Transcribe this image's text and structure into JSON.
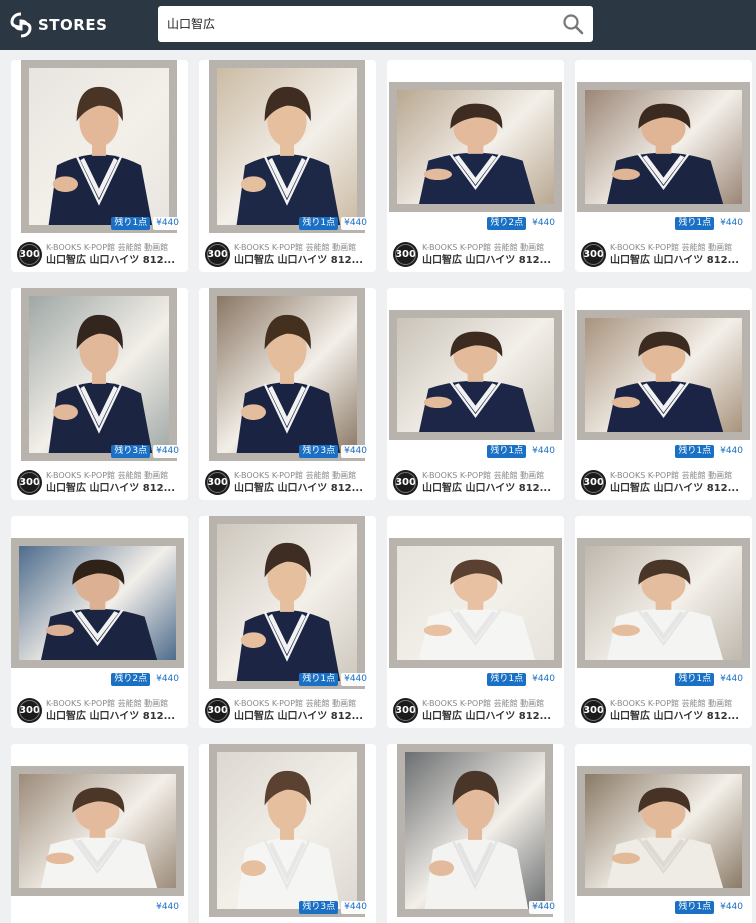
{
  "header": {
    "logo_text": "STORES",
    "search_value": "山口智広",
    "search_icon": "search-icon"
  },
  "items": [
    {
      "stock": "残り1点",
      "price": "¥440",
      "shop": "K-BOOKS K-POP館 芸能館 動画館",
      "title": "山口智広 山口ハイツ 812..."
    },
    {
      "stock": "残り1点",
      "price": "¥440",
      "shop": "K-BOOKS K-POP館 芸能館 動画館",
      "title": "山口智広 山口ハイツ 812..."
    },
    {
      "stock": "残り2点",
      "price": "¥440",
      "shop": "K-BOOKS K-POP館 芸能館 動画館",
      "title": "山口智広 山口ハイツ 812..."
    },
    {
      "stock": "残り1点",
      "price": "¥440",
      "shop": "K-BOOKS K-POP館 芸能館 動画館",
      "title": "山口智広 山口ハイツ 812..."
    },
    {
      "stock": "残り3点",
      "price": "¥440",
      "shop": "K-BOOKS K-POP館 芸能館 動画館",
      "title": "山口智広 山口ハイツ 812..."
    },
    {
      "stock": "残り3点",
      "price": "¥440",
      "shop": "K-BOOKS K-POP館 芸能館 動画館",
      "title": "山口智広 山口ハイツ 812..."
    },
    {
      "stock": "残り1点",
      "price": "¥440",
      "shop": "K-BOOKS K-POP館 芸能館 動画館",
      "title": "山口智広 山口ハイツ 812..."
    },
    {
      "stock": "残り1点",
      "price": "¥440",
      "shop": "K-BOOKS K-POP館 芸能館 動画館",
      "title": "山口智広 山口ハイツ 812..."
    },
    {
      "stock": "残り2点",
      "price": "¥440",
      "shop": "K-BOOKS K-POP館 芸能館 動画館",
      "title": "山口智広 山口ハイツ 812..."
    },
    {
      "stock": "残り1点",
      "price": "¥440",
      "shop": "K-BOOKS K-POP館 芸能館 動画館",
      "title": "山口智広 山口ハイツ 812..."
    },
    {
      "stock": "残り1点",
      "price": "¥440",
      "shop": "K-BOOKS K-POP館 芸能館 動画館",
      "title": "山口智広 山口ハイツ 812..."
    },
    {
      "stock": "残り1点",
      "price": "¥440",
      "shop": "K-BOOKS K-POP館 芸能館 動画館",
      "title": "山口智広 山口ハイツ 812..."
    },
    {
      "stock": "",
      "price": "¥440",
      "shop": "",
      "title": ""
    },
    {
      "stock": "残り3点",
      "price": "¥440",
      "shop": "",
      "title": ""
    },
    {
      "stock": "",
      "price": "¥440",
      "shop": "",
      "title": ""
    },
    {
      "stock": "残り1点",
      "price": "¥440",
      "shop": "",
      "title": ""
    }
  ],
  "avatar_text": "300",
  "colors": {
    "header_bg": "#2b3742",
    "accent": "#1a70c4",
    "page_bg": "#eff0f1"
  }
}
